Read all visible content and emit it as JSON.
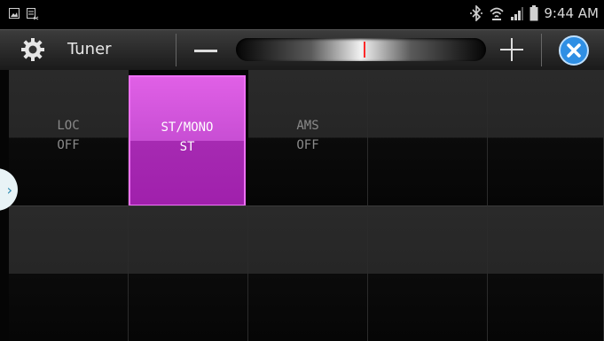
{
  "statusbar": {
    "time": "9:44 AM"
  },
  "header": {
    "title": "Tuner",
    "accent": "#2f8fe4",
    "tuning_level": 0.51
  },
  "grid": {
    "tiles": [
      {
        "line1": "LOC",
        "line2": "OFF",
        "active": false
      },
      {
        "line1": "ST/MONO",
        "line2": "ST",
        "active": true
      },
      {
        "line1": "AMS",
        "line2": "OFF",
        "active": false
      }
    ],
    "active_color": "#c84ed4"
  },
  "side_tab": {
    "glyph": "›"
  }
}
